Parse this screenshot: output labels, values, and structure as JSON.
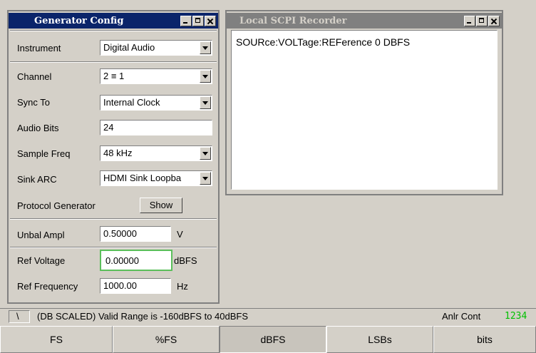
{
  "colors": {
    "desktop_bg": "#d4d0c8",
    "active_title": "#0a246a",
    "inactive_title": "#808080",
    "status_counter": "#00c000",
    "focus_border": "#5bbf5b"
  },
  "generator": {
    "title": "Generator Config",
    "instrument": {
      "label": "Instrument",
      "value": "Digital Audio"
    },
    "channel": {
      "label": "Channel",
      "value": "2 ≡ 1"
    },
    "sync_to": {
      "label": "Sync To",
      "value": "Internal Clock"
    },
    "audio_bits": {
      "label": "Audio Bits",
      "value": "24"
    },
    "sample_freq": {
      "label": "Sample Freq",
      "value": "48 kHz"
    },
    "sink_arc": {
      "label": "Sink ARC",
      "value": "HDMI Sink Loopba"
    },
    "protocol_generator": {
      "label": "Protocol Generator",
      "button": "Show"
    },
    "unbal_ampl": {
      "label": "Unbal Ampl",
      "value": "0.50000",
      "unit": "V"
    },
    "ref_voltage": {
      "label": "Ref Voltage",
      "value": "0.00000",
      "unit": "dBFS"
    },
    "ref_frequency": {
      "label": "Ref Frequency",
      "value": "1000.00",
      "unit": "Hz"
    }
  },
  "recorder": {
    "title": "Local SCPI Recorder",
    "lines": [
      "SOURce:VOLTage:REFerence 0 DBFS"
    ]
  },
  "statusbar": {
    "message": "(DB SCALED) Valid Range is -160dBFS to 40dBFS",
    "mode": "Anlr Cont",
    "counter": "1234"
  },
  "softkeys": [
    "FS",
    "%FS",
    "dBFS",
    "LSBs",
    "bits"
  ],
  "softkey_active": "dBFS"
}
